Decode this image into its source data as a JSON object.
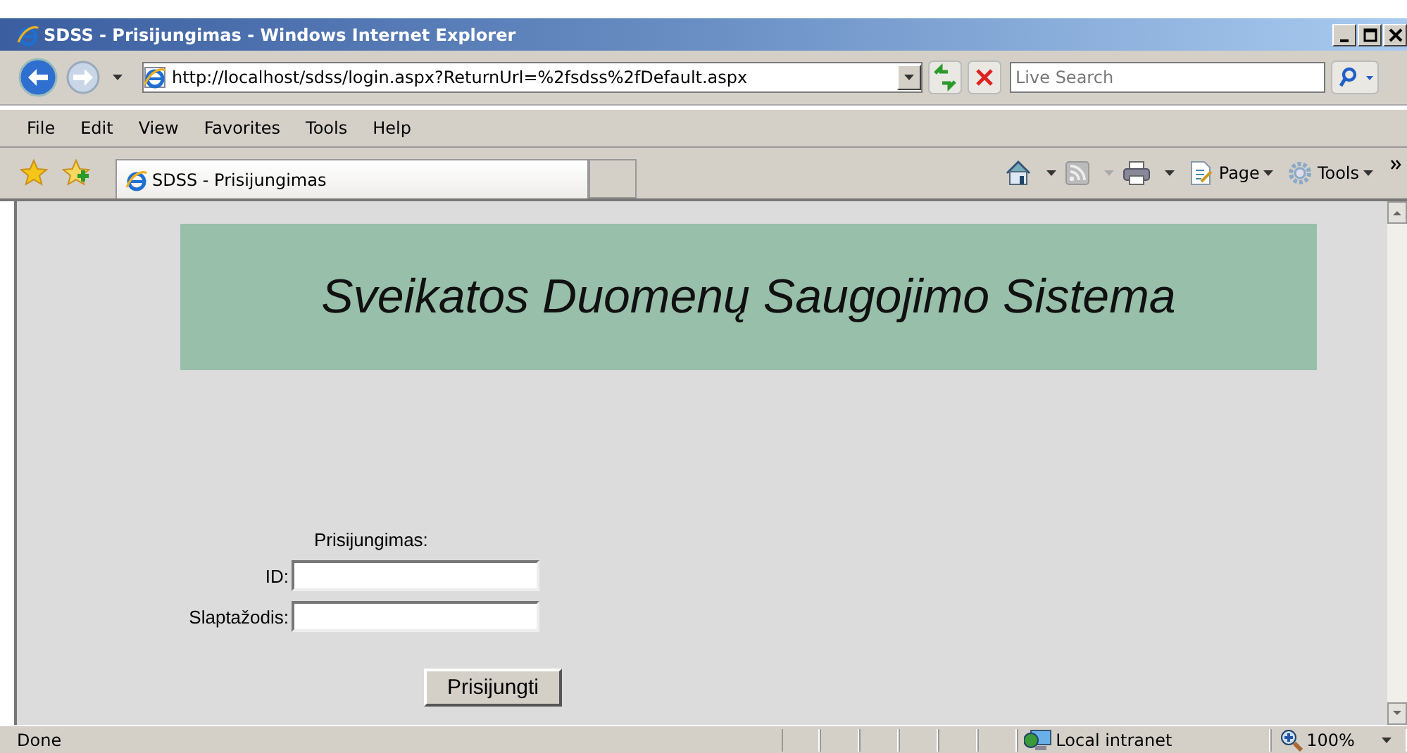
{
  "window": {
    "title": "SDSS - Prisijungimas - Windows Internet Explorer"
  },
  "address_bar": {
    "url": "http://localhost/sdss/login.aspx?ReturnUrl=%2fsdss%2fDefault.aspx"
  },
  "search": {
    "placeholder": "Live Search"
  },
  "menu": [
    "File",
    "Edit",
    "View",
    "Favorites",
    "Tools",
    "Help"
  ],
  "tabs": [
    {
      "label": "SDSS - Prisijungimas",
      "selected": true
    }
  ],
  "command_bar": [
    {
      "label": "Page",
      "kind": "page"
    },
    {
      "label": "Tools",
      "kind": "tools"
    }
  ],
  "page": {
    "banner": "Sveikatos Duomenų Saugojimo Sistema",
    "form_title": "Prisijungimas:",
    "fields": [
      {
        "label": "ID:"
      },
      {
        "label": "Slaptažodis:"
      }
    ],
    "button": "Prisijungti"
  },
  "status_bar": {
    "text": "Done",
    "zone": "Local intranet",
    "zoom": "100%"
  }
}
